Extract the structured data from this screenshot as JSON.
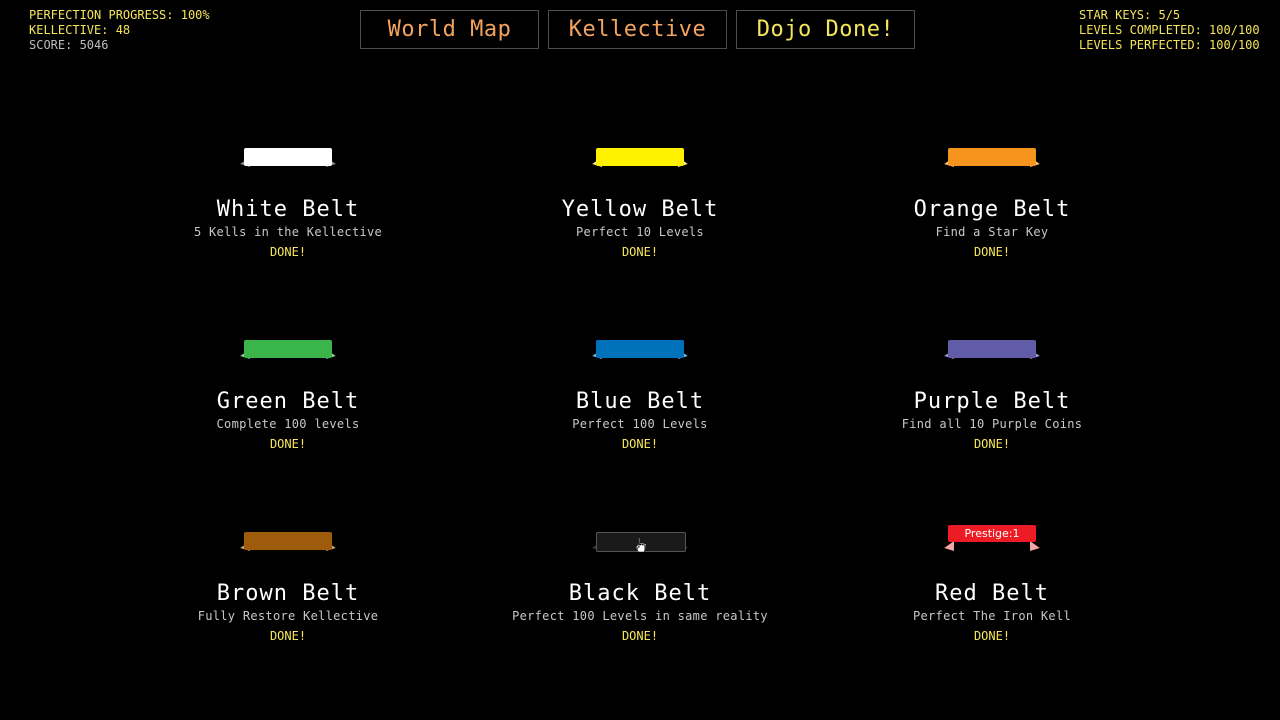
{
  "stats_left": {
    "perfection": "PERFECTION PROGRESS: 100%",
    "kellective": "KELLECTIVE: 48",
    "score": "SCORE: 5046"
  },
  "stats_right": {
    "star_keys": "STAR KEYS: 5/5",
    "levels_completed": "LEVELS COMPLETED: 100/100",
    "levels_perfected": "LEVELS PERFECTED: 100/100"
  },
  "nav": {
    "world_map": "World Map",
    "kellective": "Kellective",
    "dojo_done": "Dojo Done!"
  },
  "colors": {
    "nav_orange": "#f2a35e",
    "nav_yellow": "#f5e55a",
    "done_yellow": "#f5e55a"
  },
  "belts": [
    {
      "name": "White Belt",
      "requirement": "5 Kells in the Kellective",
      "status": "DONE!",
      "color": "#ffffff",
      "tail_color": "#8a8a8a",
      "badge": ""
    },
    {
      "name": "Yellow Belt",
      "requirement": "Perfect 10 Levels",
      "status": "DONE!",
      "color": "#fff200",
      "tail_color": "#fff07a",
      "badge": ""
    },
    {
      "name": "Orange Belt",
      "requirement": "Find a Star Key",
      "status": "DONE!",
      "color": "#f7941d",
      "tail_color": "#f8c08a",
      "badge": ""
    },
    {
      "name": "Green Belt",
      "requirement": "Complete 100 levels",
      "status": "DONE!",
      "color": "#39b54a",
      "tail_color": "#8ac79a",
      "badge": ""
    },
    {
      "name": "Blue Belt",
      "requirement": "Perfect 100 Levels",
      "status": "DONE!",
      "color": "#0072bc",
      "tail_color": "#7aaed6",
      "badge": ""
    },
    {
      "name": "Purple Belt",
      "requirement": "Find all 10 Purple Coins",
      "status": "DONE!",
      "color": "#605ca8",
      "tail_color": "#9c99c9",
      "badge": ""
    },
    {
      "name": "Brown Belt",
      "requirement": "Fully Restore Kellective",
      "status": "DONE!",
      "color": "#9e5b0b",
      "tail_color": "#c4a072",
      "badge": ""
    },
    {
      "name": "Black Belt",
      "requirement": "Perfect 100 Levels in same reality",
      "status": "DONE!",
      "color": "#1a1a1a",
      "tail_color": "#3a3a3a",
      "badge": ""
    },
    {
      "name": "Red Belt",
      "requirement": "Perfect The Iron Kell",
      "status": "DONE!",
      "color": "#ed1c24",
      "tail_color": "#f4a6a6",
      "badge": "Prestige:1"
    }
  ]
}
